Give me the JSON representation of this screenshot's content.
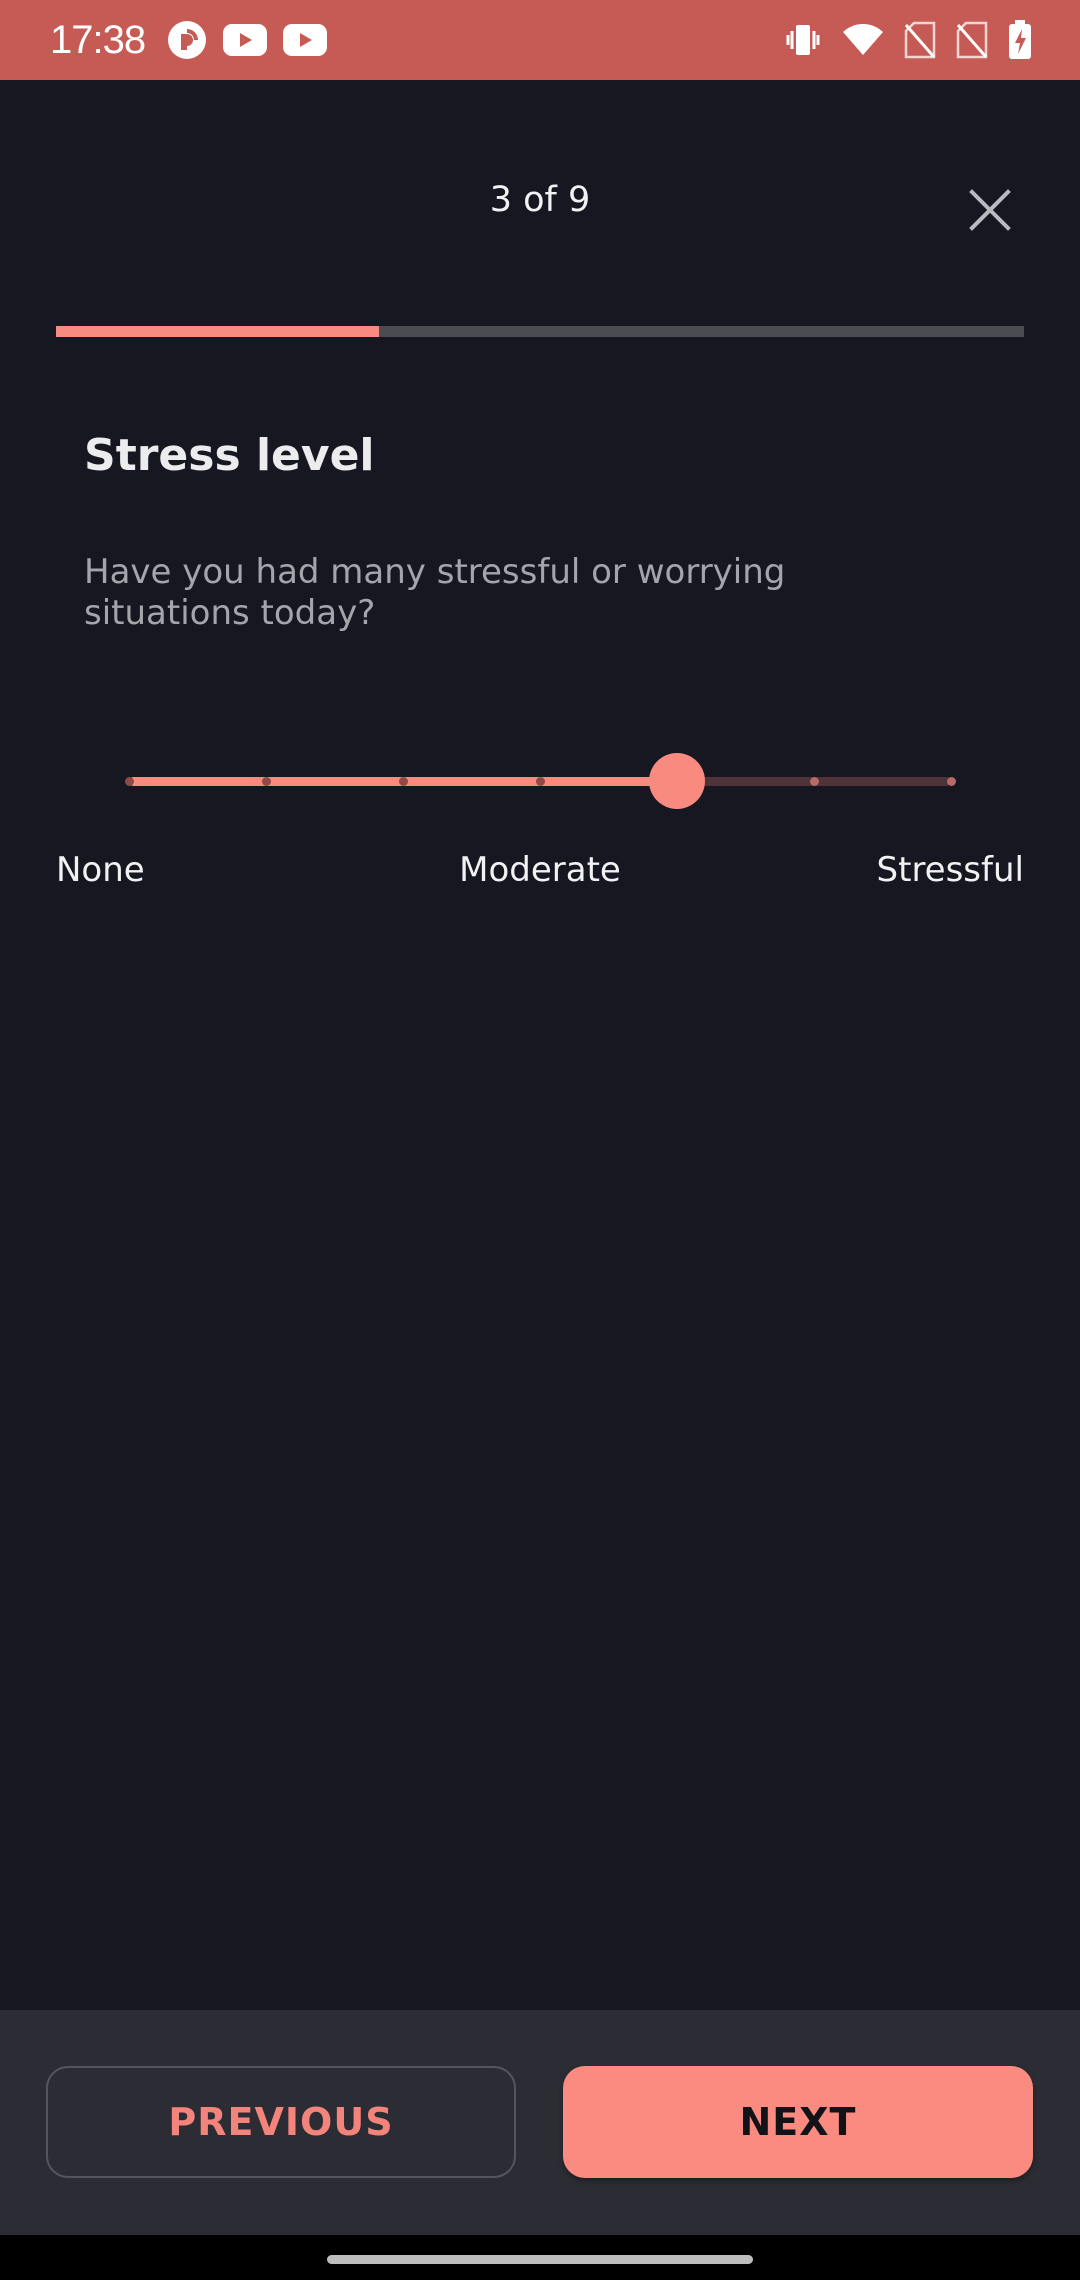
{
  "status_bar": {
    "time": "17:38",
    "left_icons": [
      "pocket-casts-icon",
      "youtube-icon",
      "youtube-icon"
    ],
    "right_icons": [
      "vibrate-icon",
      "wifi-icon",
      "no-sim-icon",
      "no-sim-icon",
      "battery-charging-icon"
    ]
  },
  "header": {
    "step_counter": "3 of 9",
    "close_icon": "close-icon"
  },
  "progress": {
    "current": 3,
    "total": 9,
    "fraction": 0.3333
  },
  "question": {
    "title": "Stress level",
    "text": "Have you had many stressful or worrying situations today?"
  },
  "slider": {
    "min": 0,
    "max": 6,
    "value": 4,
    "step_count": 7,
    "labels": {
      "min": "None",
      "mid": "Moderate",
      "max": "Stressful"
    }
  },
  "footer": {
    "previous_label": "PREVIOUS",
    "next_label": "NEXT"
  },
  "colors": {
    "accent": "#f88a80",
    "background": "#161720",
    "status_bar": "#c65b55",
    "bottom_bar": "#2c2d34"
  }
}
